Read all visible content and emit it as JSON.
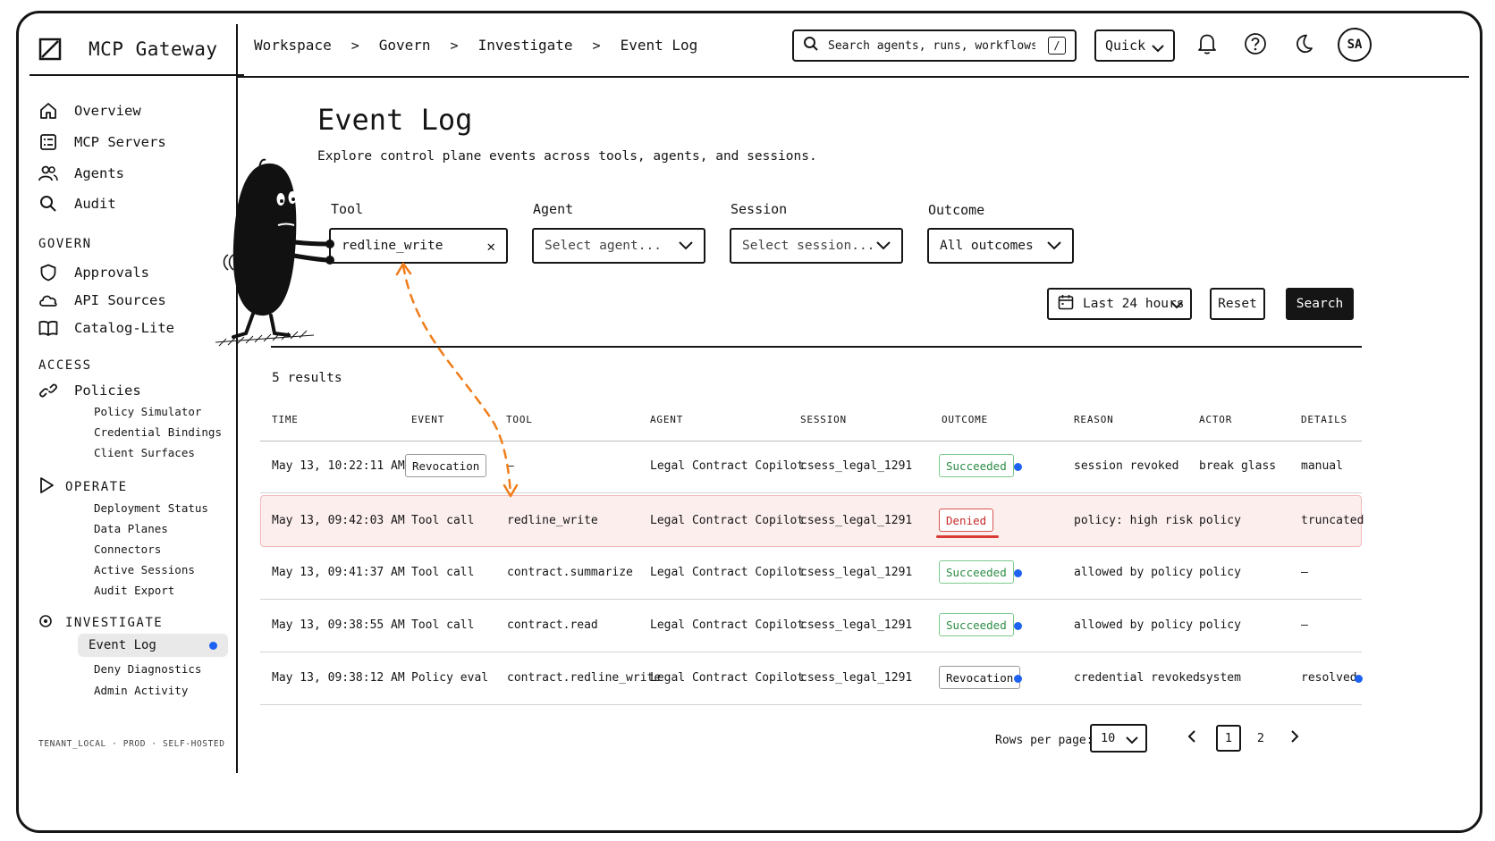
{
  "app": {
    "name": "MCP Gateway",
    "tenant_footer": "TENANT_LOCAL · PROD · SELF-HOSTED"
  },
  "sidebar": {
    "top_items": [
      {
        "label": "Overview",
        "icon": "home-icon"
      },
      {
        "label": "MCP Servers",
        "icon": "server-list-icon"
      },
      {
        "label": "Agents",
        "icon": "users-icon"
      },
      {
        "label": "Audit",
        "icon": "search-icon"
      }
    ],
    "govern": {
      "title": "GOVERN",
      "items": [
        {
          "label": "Approvals",
          "icon": "shield-icon"
        },
        {
          "label": "API Sources",
          "icon": "cloud-icon"
        },
        {
          "label": "Catalog-Lite",
          "icon": "book-icon"
        }
      ]
    },
    "access": {
      "title": "ACCESS",
      "items": [
        {
          "label": "Policies",
          "icon": "link-icon"
        }
      ],
      "sub_items": [
        "Policy Simulator",
        "Credential Bindings",
        "Client Surfaces"
      ]
    },
    "operate": {
      "title": "OPERATE",
      "sub_items": [
        "Deployment Status",
        "Data Planes",
        "Connectors",
        "Active Sessions",
        "Audit Export"
      ]
    },
    "investigate": {
      "title": "INVESTIGATE",
      "active": "Event Log",
      "sub_items": [
        "Deny Diagnostics",
        "Admin Activity"
      ]
    }
  },
  "topbar": {
    "breadcrumb": [
      "Workspace",
      "Govern",
      "Investigate",
      "Event Log"
    ],
    "search_placeholder": "Search agents, runs, workflows...",
    "search_shortcut": "/",
    "quick_label": "Quick",
    "avatar_initials": "SA"
  },
  "page": {
    "title": "Event Log",
    "subtitle": "Explore control plane events across tools, agents, and sessions."
  },
  "filters": {
    "tool": {
      "label": "Tool",
      "value": "redline_write"
    },
    "agent": {
      "label": "Agent",
      "placeholder": "Select agent..."
    },
    "session": {
      "label": "Session",
      "placeholder": "Select session..."
    },
    "outcome": {
      "label": "Outcome",
      "value": "All outcomes"
    },
    "date_range": "Last 24 hours",
    "reset_label": "Reset",
    "search_label": "Search"
  },
  "results": {
    "count_label": "5 results",
    "columns": [
      "TIME",
      "EVENT",
      "TOOL",
      "AGENT",
      "SESSION",
      "OUTCOME",
      "REASON",
      "ACTOR",
      "DETAILS"
    ],
    "rows": [
      {
        "time": "May 13, 10:22:11 AM",
        "event": "Revocation",
        "event_badge": true,
        "tool": "—",
        "agent": "Legal Contract Copilot",
        "session": "csess_legal_1291",
        "outcome": "Succeeded",
        "outcome_kind": "succeeded",
        "outcome_dot": true,
        "reason": "session revoked",
        "actor": "break glass",
        "details": "manual",
        "details_dot": false
      },
      {
        "time": "May 13, 09:42:03 AM",
        "event": "Tool call",
        "event_badge": false,
        "tool": "redline_write",
        "agent": "Legal Contract Copilot",
        "session": "csess_legal_1291",
        "outcome": "Denied",
        "outcome_kind": "denied",
        "outcome_dot": false,
        "reason": "policy: high risk",
        "actor": "policy",
        "details": "truncated",
        "details_dot": false
      },
      {
        "time": "May 13, 09:41:37 AM",
        "event": "Tool call",
        "event_badge": false,
        "tool": "contract.summarize",
        "agent": "Legal Contract Copilot",
        "session": "csess_legal_1291",
        "outcome": "Succeeded",
        "outcome_kind": "succeeded",
        "outcome_dot": true,
        "reason": "allowed by policy",
        "actor": "policy",
        "details": "—",
        "details_dot": false
      },
      {
        "time": "May 13, 09:38:55 AM",
        "event": "Tool call",
        "event_badge": false,
        "tool": "contract.read",
        "agent": "Legal Contract Copilot",
        "session": "csess_legal_1291",
        "outcome": "Succeeded",
        "outcome_kind": "succeeded",
        "outcome_dot": true,
        "reason": "allowed by policy",
        "actor": "policy",
        "details": "—",
        "details_dot": false
      },
      {
        "time": "May 13, 09:38:12 AM",
        "event": "Policy eval",
        "event_badge": false,
        "tool": "contract.redline_write",
        "agent": "Legal Contract Copilot",
        "session": "csess_legal_1291",
        "outcome": "Revocation",
        "outcome_kind": "revocation",
        "outcome_dot": true,
        "reason": "credential revoked",
        "actor": "system",
        "details": "resolved",
        "details_dot": true
      }
    ]
  },
  "pagination": {
    "rows_label": "Rows per page:",
    "rows_value": "10",
    "pages": [
      "1",
      "2"
    ],
    "current": "1"
  },
  "colors": {
    "accent": "#1d62f0",
    "success": "#2c8c45",
    "danger": "#c62b28",
    "arrow": "#f07d1a"
  }
}
